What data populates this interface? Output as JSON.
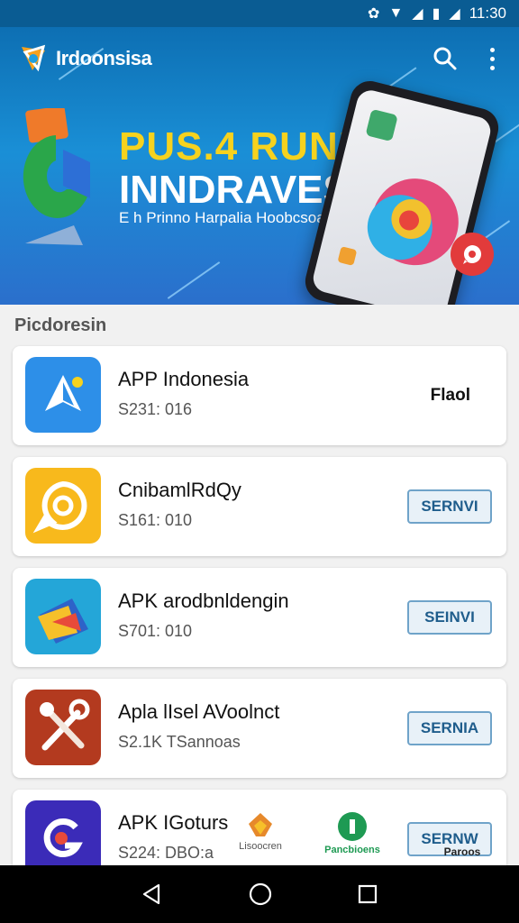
{
  "status_bar": {
    "time": "11:30"
  },
  "app_bar": {
    "logo_text": "Irdoonsisa"
  },
  "hero": {
    "title_line1": "PUS.4 RUNESL",
    "title_line2": "INNDRAVESIAN",
    "subtitle": "E h Prinno Harpalia Hoobcsoants"
  },
  "section": {
    "title": "Picdoresin"
  },
  "apps": [
    {
      "name": "APP Indonesia",
      "meta": "S231: 016",
      "action": "Flaol",
      "action_style": "text"
    },
    {
      "name": "CnibamlRdQy",
      "meta": "S161: 010",
      "action": "SERNVI",
      "action_style": "button"
    },
    {
      "name": "APK arodbnldengin",
      "meta": "S701: 010",
      "action": "SEINVI",
      "action_style": "button"
    },
    {
      "name": "Apla lIsel AVoolnct",
      "meta": "S2.1K TSannoas",
      "action": "SERNIA",
      "action_style": "button"
    },
    {
      "name": "APK IGoturs",
      "meta": "S224: DBO:a",
      "action": "SERNW",
      "action_style": "button"
    }
  ],
  "bottom_items": [
    {
      "label": "Lisoocren",
      "icon": "flame-icon",
      "color": "#e6892b"
    },
    {
      "label": "Pancbioens",
      "icon": "green-badge-icon",
      "color": "#1e9a53"
    },
    {
      "label": "Paroos",
      "icon": "none",
      "color": "#222222"
    }
  ],
  "colors": {
    "accent_blue": "#1a8fd6",
    "title_yellow": "#f6d21e",
    "button_border": "#6fa3c9"
  }
}
